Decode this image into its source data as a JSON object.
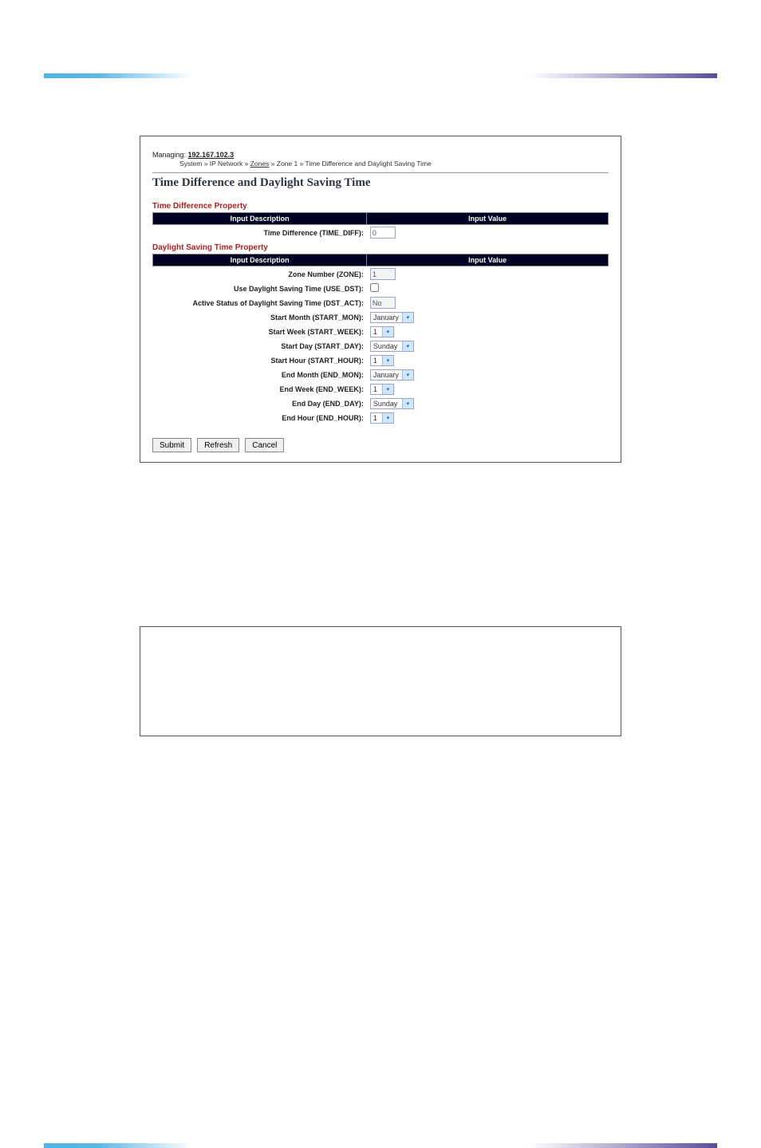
{
  "header": {
    "managing_label": "Managing:",
    "managing_ip": "192.167.102.3"
  },
  "breadcrumb": {
    "items": [
      "System",
      "IP Network",
      "Zones",
      "Zone 1",
      "Time Difference and Daylight Saving Time"
    ],
    "link_indices": [
      2
    ]
  },
  "page_title": "Time Difference and Daylight Saving Time",
  "sections": {
    "time_diff": {
      "title": "Time Difference Property",
      "col_desc": "Input Description",
      "col_val": "Input Value",
      "rows": [
        {
          "label": "Time Difference (TIME_DIFF):",
          "type": "text",
          "value": "0",
          "disabled": false
        }
      ]
    },
    "dst": {
      "title": "Daylight Saving Time Property",
      "col_desc": "Input Description",
      "col_val": "Input Value",
      "rows": [
        {
          "label": "Zone Number (ZONE):",
          "type": "text",
          "value": "1",
          "disabled": true
        },
        {
          "label": "Use Daylight Saving Time (USE_DST):",
          "type": "checkbox",
          "value": ""
        },
        {
          "label": "Active Status of Daylight Saving Time (DST_ACT):",
          "type": "text",
          "value": "No",
          "disabled": true
        },
        {
          "label": "Start Month (START_MON):",
          "type": "dropdown_wide",
          "value": "January"
        },
        {
          "label": "Start Week (START_WEEK):",
          "type": "dropdown_narrow",
          "value": "1"
        },
        {
          "label": "Start Day (START_DAY):",
          "type": "dropdown_wide",
          "value": "Sunday"
        },
        {
          "label": "Start Hour (START_HOUR):",
          "type": "dropdown_narrow",
          "value": "1"
        },
        {
          "label": "End Month (END_MON):",
          "type": "dropdown_wide",
          "value": "January"
        },
        {
          "label": "End Week (END_WEEK):",
          "type": "dropdown_narrow",
          "value": "1"
        },
        {
          "label": "End Day (END_DAY):",
          "type": "dropdown_wide",
          "value": "Sunday"
        },
        {
          "label": "End Hour (END_HOUR):",
          "type": "dropdown_narrow",
          "value": "1"
        }
      ]
    }
  },
  "buttons": {
    "submit": "Submit",
    "refresh": "Refresh",
    "cancel": "Cancel"
  }
}
